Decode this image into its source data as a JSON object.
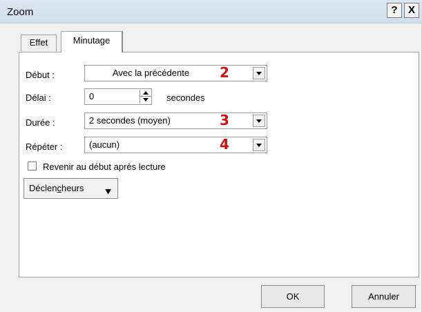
{
  "window": {
    "title": "Zoom",
    "help_label": "?",
    "close_label": "X"
  },
  "tabs": [
    {
      "label": "Effet"
    },
    {
      "label": "Minutage"
    }
  ],
  "form": {
    "debut": {
      "label": "Début :",
      "value": "Avec la précédente",
      "marker": "2"
    },
    "delai": {
      "label": "Délai :",
      "value": "0",
      "unit": "secondes"
    },
    "duree": {
      "label": "Durée :",
      "value": "2 secondes (moyen)",
      "marker": "3"
    },
    "repeter": {
      "label": "Répéter :",
      "value": "(aucun)",
      "marker": "4"
    },
    "rewind": {
      "label": "Revenir au début après lecture",
      "checked": false
    }
  },
  "triggers": {
    "label_pre": "Déclen",
    "label_accel": "c",
    "label_post": "heurs",
    "icon": "double-chevron-down-icon"
  },
  "buttons": {
    "ok": "OK",
    "cancel": "Annuler"
  }
}
